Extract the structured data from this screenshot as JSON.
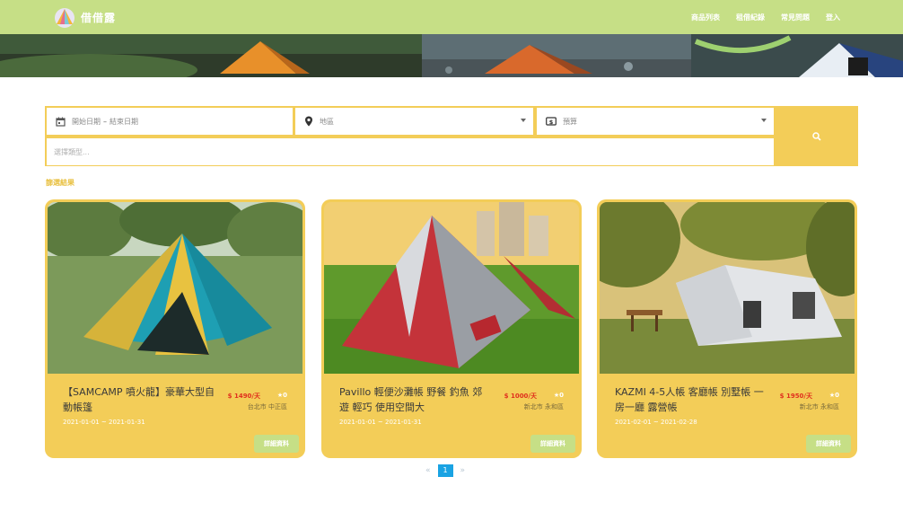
{
  "nav": {
    "brand": "借借露",
    "links": [
      "商品列表",
      "租借紀錄",
      "常見問題",
      "登入"
    ]
  },
  "search": {
    "date_placeholder_start": "開始日期",
    "date_separator": "–",
    "date_placeholder_end": "結束日期",
    "region_placeholder": "地區",
    "budget_placeholder": "預算",
    "type_placeholder": "選擇類型..."
  },
  "filter_label": "篩選結果",
  "products": [
    {
      "title": "【SAMCAMP 噴火龍】豪華大型自動帳篷",
      "price": "$ 1490/天",
      "rating": "★0",
      "location": "台北市 中正區",
      "dates": "2021-01-01 ~ 2021-01-31",
      "button": "詳細資料"
    },
    {
      "title": "Pavillo 輕便沙灘帳 野餐 釣魚 郊遊 輕巧 使用空間大",
      "price": "$ 1000/天",
      "rating": "★0",
      "location": "新北市 永和區",
      "dates": "2021-01-01 ~ 2021-01-31",
      "button": "詳細資料"
    },
    {
      "title": "KAZMI 4-5人帳 客廳帳 別墅帳 一房一廳 露營帳",
      "price": "$ 1950/天",
      "rating": "★0",
      "location": "新北市 永和區",
      "dates": "2021-02-01 ~ 2021-02-28",
      "button": "詳細資料"
    }
  ],
  "pagination": {
    "prev": "«",
    "current": "1",
    "next": "»"
  },
  "colors": {
    "nav_bg": "#c6df86",
    "accent_yellow": "#f3cd58",
    "price_red": "#e0301e",
    "page_blue": "#1aa3e3"
  }
}
